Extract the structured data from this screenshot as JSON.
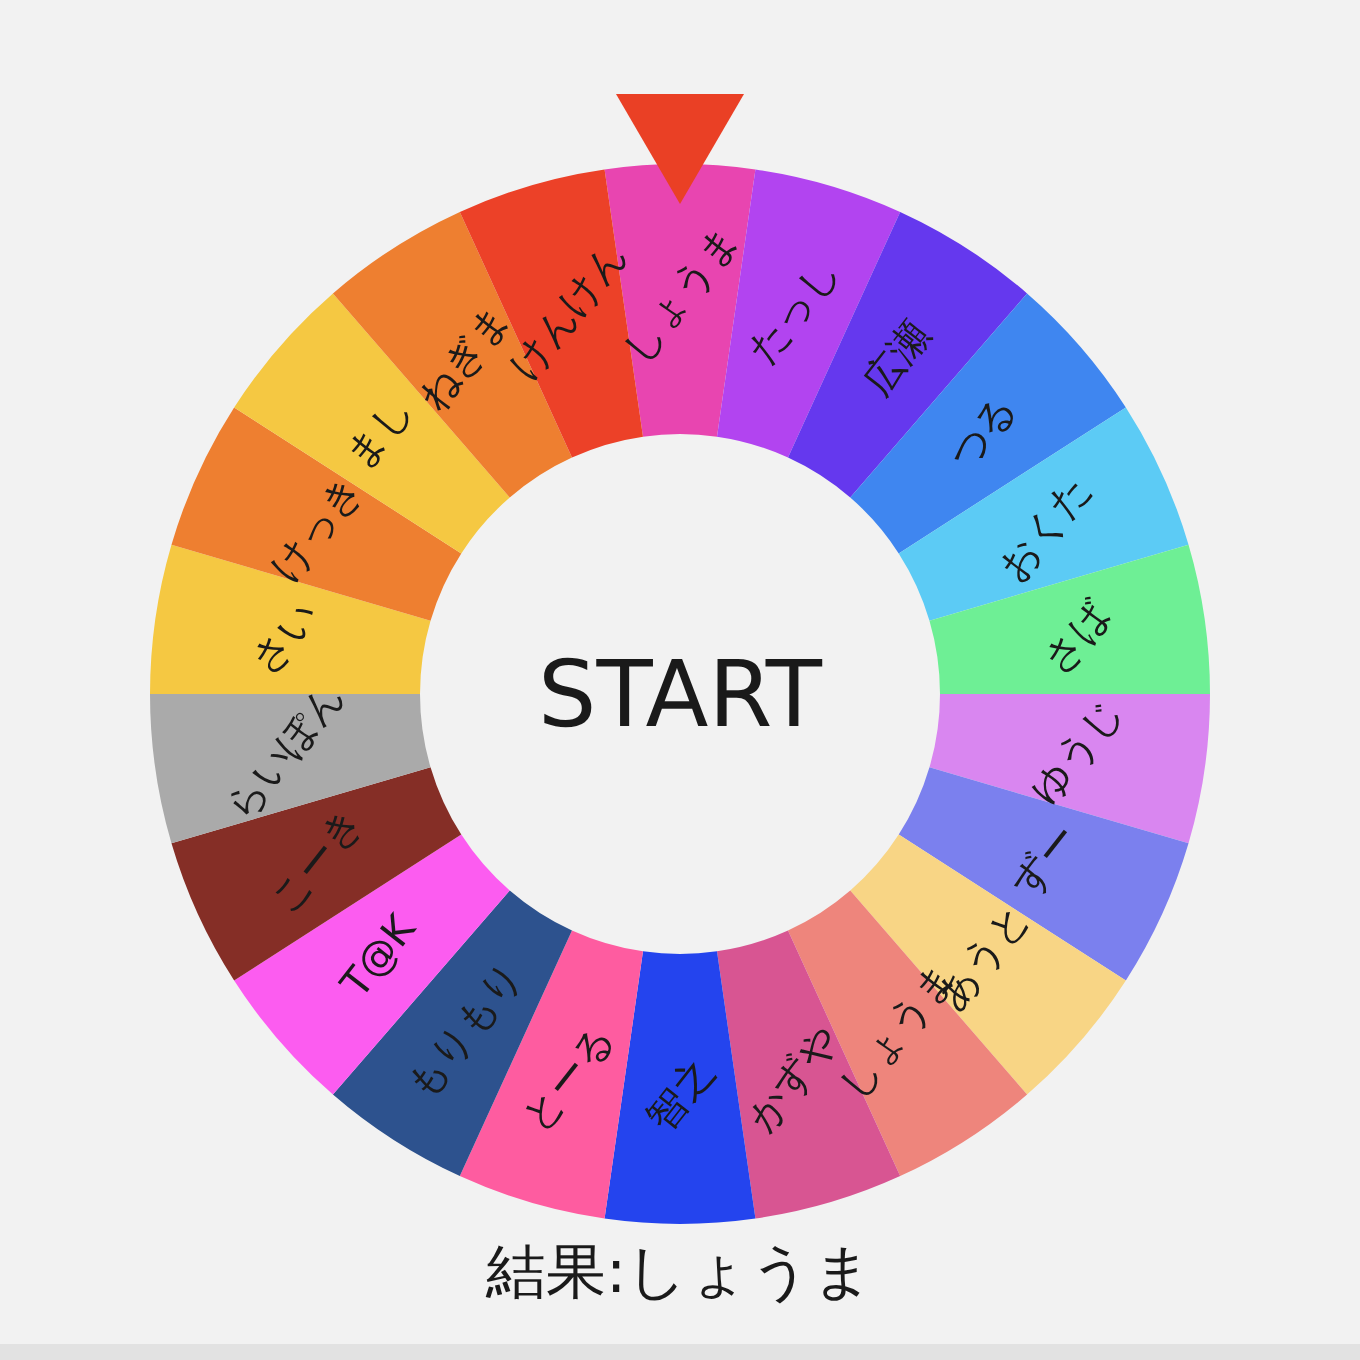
{
  "wheel": {
    "center_button": "START",
    "segments": [
      {
        "label": "しょうま",
        "color": "#e845b0"
      },
      {
        "label": "たっし",
        "color": "#b244f0"
      },
      {
        "label": "広瀬",
        "color": "#6538ee"
      },
      {
        "label": "つる",
        "color": "#3f86f0"
      },
      {
        "label": "おくた",
        "color": "#5ccbf5"
      },
      {
        "label": "さば",
        "color": "#6eef95"
      },
      {
        "label": "ゆうじ",
        "color": "#d986f0"
      },
      {
        "label": "ずー",
        "color": "#7b80ee"
      },
      {
        "label": "あうと",
        "color": "#f8d585"
      },
      {
        "label": "しょうま",
        "color": "#ee857c"
      },
      {
        "label": "かずや",
        "color": "#d85592"
      },
      {
        "label": "智之",
        "color": "#2444ee"
      },
      {
        "label": "とーる",
        "color": "#fe5ca0"
      },
      {
        "label": "もりもり",
        "color": "#2d528e"
      },
      {
        "label": "T@K",
        "color": "#fc5cf0"
      },
      {
        "label": "こーき",
        "color": "#852e26"
      },
      {
        "label": "らいぽん",
        "color": "#aaaaaa"
      },
      {
        "label": "さい",
        "color": "#f5c842"
      },
      {
        "label": "けっき",
        "color": "#ee7f30"
      },
      {
        "label": "まし",
        "color": "#f5c842"
      },
      {
        "label": "ねぎま",
        "color": "#ee7f30"
      },
      {
        "label": "けんけん",
        "color": "#ec4128"
      }
    ]
  },
  "result": "結果:しょうま"
}
